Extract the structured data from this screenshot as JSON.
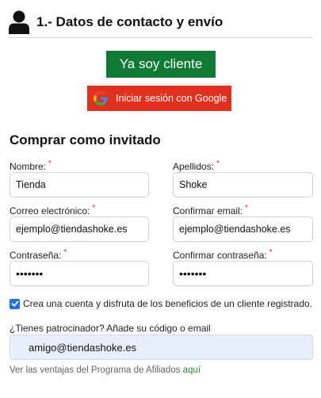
{
  "section": {
    "title": "1.- Datos de contacto y envío"
  },
  "buttons": {
    "existing_client": "Ya soy cliente",
    "google_login": "Iniciar sesión con Google"
  },
  "guest": {
    "title": "Comprar como invitado",
    "required_mark": "*",
    "fields": {
      "nombre": {
        "label": "Nombre:",
        "value": "Tienda"
      },
      "apellidos": {
        "label": "Apellidos:",
        "value": "Shoke"
      },
      "email": {
        "label": "Correo electrónico:",
        "value": "ejemplo@tiendashoke.es"
      },
      "email_confirm": {
        "label": "Confirmar email:",
        "value": "ejemplo@tiendashoke.es"
      },
      "password": {
        "label": "Contraseña:",
        "value": "•••••••"
      },
      "password_confirm": {
        "label": "Confirmar contraseña:",
        "value": "•••••••"
      }
    },
    "create_account": {
      "label": "Crea una cuenta y disfruta de los beneficios de un cliente registrado.",
      "checked": true
    },
    "referral": {
      "label": "¿Tienes patrocinador? Añade su código o email",
      "value": "amigo@tiendashoke.es"
    },
    "affiliate": {
      "text": "Ver las ventajas del Programa de Afiliados",
      "link": "aquí"
    }
  },
  "colors": {
    "client_button": "#0f7a34",
    "google_button": "#e0301e",
    "required": "#d3282e",
    "link": "#2e8b3a",
    "checkbox": "#1a73e8"
  },
  "icons": {
    "header": "user-icon",
    "google": "google-icon",
    "checkbox": "checkmark-icon"
  }
}
